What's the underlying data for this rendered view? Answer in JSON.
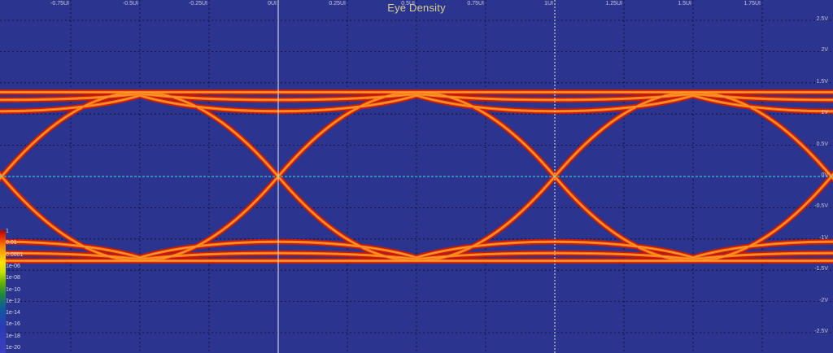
{
  "chart_data": {
    "type": "eye_diagram",
    "title": "Eye Density",
    "x_ticks": [
      "-0.75UI",
      "-0.5UI",
      "-0.25UI",
      "0UI",
      "0.25UI",
      "0.5UI",
      "0.75UI",
      "1UI",
      "1.25UI",
      "1.5UI",
      "1.75UI"
    ],
    "x_tick_values": [
      -0.75,
      -0.5,
      -0.25,
      0,
      0.25,
      0.5,
      0.75,
      1,
      1.25,
      1.5,
      1.75
    ],
    "xlim": [
      -1.0,
      2.0
    ],
    "y_ticks": [
      "2.5V",
      "2V",
      "1.5V",
      "1V",
      "0.5V",
      "0V",
      "-0.5V",
      "-1V",
      "-1.5V",
      "-2V",
      "-2.5V"
    ],
    "y_tick_values": [
      2.5,
      2,
      1.5,
      1,
      0.5,
      0,
      -0.5,
      -1,
      -1.5,
      -2,
      -2.5
    ],
    "ylim": [
      -2.8,
      2.8
    ],
    "high_level_v": 1.35,
    "low_level_v": -1.35,
    "crossing_ui": [
      0,
      1
    ],
    "threshold_v": 0,
    "grid": true,
    "colorbar": {
      "labels": [
        "1",
        "0.01",
        "0.0001",
        "1e-06",
        "1e-08",
        "1e-10",
        "1e-12",
        "1e-14",
        "1e-16",
        "1e-18",
        "1e-20"
      ]
    },
    "colors": {
      "background": "#2b3590",
      "trace_core": "#ff7a10",
      "trace_edge": "#d01800",
      "threshold": "#40e0e0",
      "grid": "#0b0b20",
      "marker_line": "#e8e8e8"
    }
  }
}
